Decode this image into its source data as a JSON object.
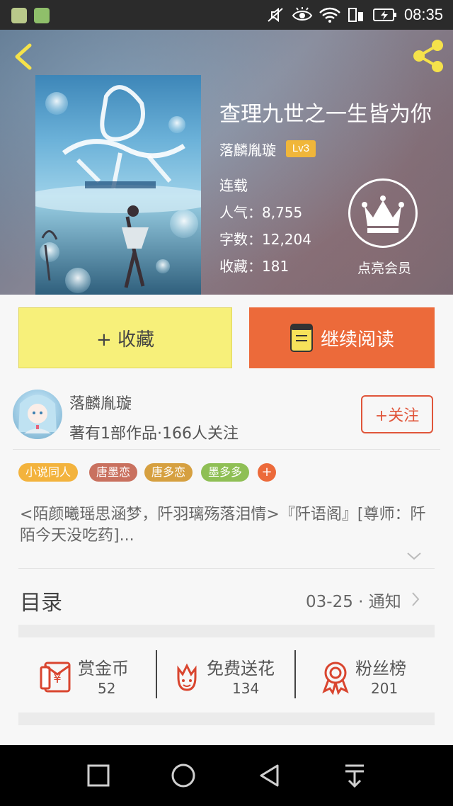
{
  "status_bar": {
    "time": "08:35"
  },
  "book": {
    "title": "查理九世之一生皆为你",
    "author": "落麟胤璇",
    "level": "Lv3",
    "status": "连载",
    "popularity_label": "人气：",
    "popularity": "8,755",
    "word_count_label": "字数：",
    "word_count": "12,204",
    "collections_label": "收藏：",
    "collections": "181",
    "vip_label": "点亮会员"
  },
  "actions": {
    "collect": "+ 收藏",
    "continue_reading": "继续阅读"
  },
  "author_card": {
    "name": "落麟胤璇",
    "subtitle": "著有1部作品·166人关注",
    "follow": "+关注"
  },
  "tags": [
    {
      "label": "小说同人",
      "color": "#f3b33d"
    },
    {
      "label": "唐墨恋",
      "color": "#c9715f"
    },
    {
      "label": "唐多恋",
      "color": "#d6a040"
    },
    {
      "label": "墨多多",
      "color": "#8fbf55"
    }
  ],
  "tag_add": "+",
  "description": "<陌颜曦瑶思涵梦，阡羽璃殇落泪情>『阡语阁』[尊师：阡陌今天没吃药]...",
  "catalog": {
    "label": "目录",
    "update": "03-25 · 通知"
  },
  "stats": [
    {
      "label": "赏金币",
      "value": "52",
      "icon": "reward-coin-icon"
    },
    {
      "label": "免费送花",
      "value": "134",
      "icon": "flower-icon"
    },
    {
      "label": "粉丝榜",
      "value": "201",
      "icon": "fan-rank-icon"
    }
  ],
  "colors": {
    "accent": "#ec6a3a",
    "collect_bg": "#f7f07a",
    "vip_badge": "#f0b63a"
  }
}
